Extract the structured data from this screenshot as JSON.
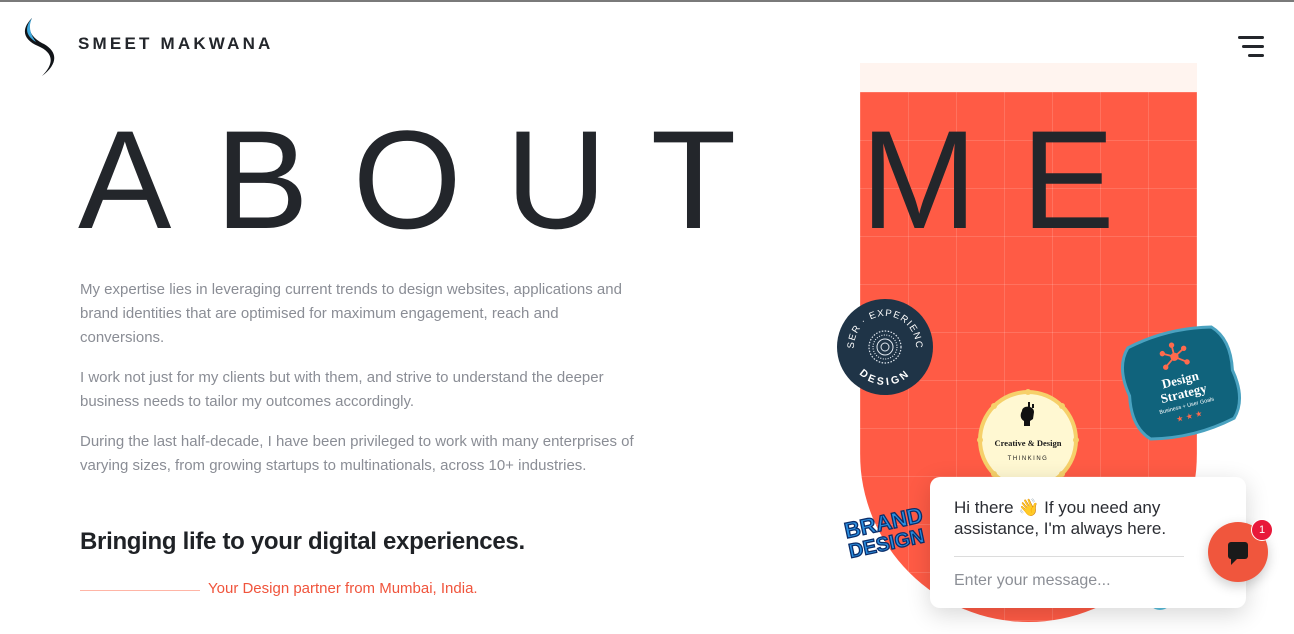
{
  "header": {
    "brand": "SMEET MAKWANA",
    "logo_icon": "swirl-s-logo",
    "menu_icon": "hamburger-menu-icon"
  },
  "hero": {
    "title": "ABOUT ME",
    "paragraphs": [
      "My expertise lies in leveraging current trends to design websites, applications and brand identities that are optimised for maximum engagement, reach and conversions.",
      "I work not just for my clients but with them, and strive to understand the deeper business needs to tailor my outcomes accordingly.",
      "During the last half-decade, I have been privileged to work with many enterprises of varying sizes, from growing startups to multinationals, across 10+ industries."
    ],
    "tagline": "Bringing life to your digital experiences.",
    "partner": "Your Design partner from Mumbai, India."
  },
  "badges": {
    "ux_top": "USER · EXPERIENCE",
    "ux_bottom": "DESIGN",
    "creative_main": "Creative & Design",
    "creative_sub": "THINKING",
    "strategy_main_1": "Design",
    "strategy_main_2": "Strategy",
    "strategy_sub": "Business + User Goals",
    "brand_1": "BRAND",
    "brand_2": "DESIGN"
  },
  "chat": {
    "greeting": "Hi there 👋 If you need any assistance, I'm always here.",
    "placeholder": "Enter your message...",
    "unread_count": "1",
    "icon": "chat-bubble-icon"
  },
  "colors": {
    "accent": "#ff5b45",
    "text_dark": "#23262b",
    "text_muted": "#8a8d95",
    "badge_teal": "#10637c",
    "badge_navy": "#1f3447"
  }
}
